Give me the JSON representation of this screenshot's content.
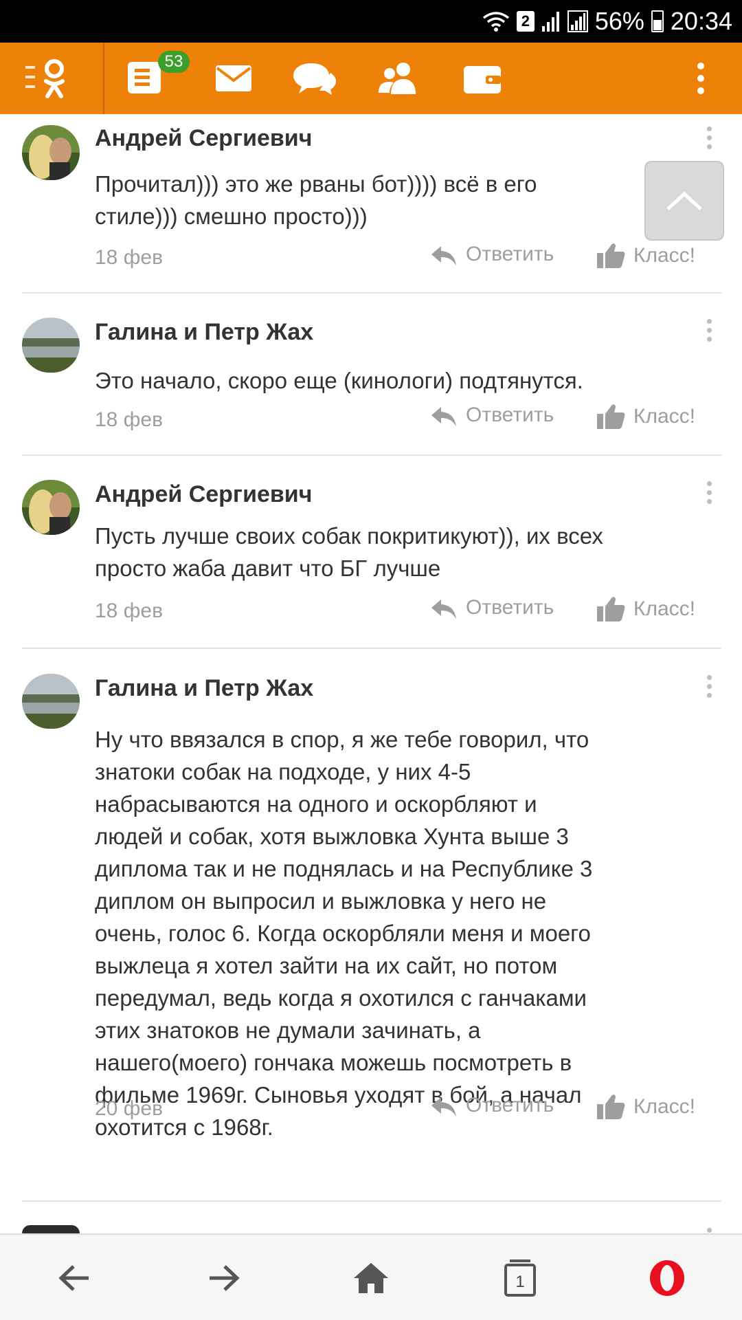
{
  "status_bar": {
    "sim": "2",
    "battery": "56%",
    "time": "20:34",
    "icons": [
      "wifi-icon",
      "signal-icon",
      "signal-icon",
      "battery-icon"
    ]
  },
  "app_bar": {
    "brand_color": "#ee8208",
    "notifications_badge": "53",
    "icons": [
      "ok-menu-icon",
      "feed-icon",
      "mail-icon",
      "chat-icon",
      "friends-icon",
      "wallet-icon",
      "more-vertical-icon"
    ]
  },
  "comments": [
    {
      "author": "Андрей Сергиевич",
      "text": "Прочитал))) это же рваны бот)))) всё в его\nстиле))) смешно просто)))",
      "date": "18 фев",
      "reply_label": "Ответить",
      "like_label": "Класс!"
    },
    {
      "author": "Галина и Петр Жах",
      "text": "Это начало, скоро  еще  (кинологи) подтянутся.",
      "date": "18 фев",
      "reply_label": "Ответить",
      "like_label": "Класс!"
    },
    {
      "author": "Андрей Сергиевич",
      "text": "Пусть лучше своих собак покритикуют)), их всех\nпросто жаба давит что БГ лучше",
      "date": "18 фев",
      "reply_label": "Ответить",
      "like_label": "Класс!"
    },
    {
      "author": "Галина и Петр Жах",
      "text": "Ну что ввязался в спор, я же тебе говорил,  что\nзнатоки собак на подходе, у них 4-5\nнабрасываются на одного и оскорбляют и\nлюдей и собак, хотя выжловка Хунта выше 3\nдиплома так и не поднялась  и на  Республике 3\nдиплом он выпросил и выжловка у него не\nочень, голос 6. Когда оскорбляли меня и моего\nвыжлеца  я хотел зайти на их сайт, но потом\nпередумал, ведь когда я охотился с ганчаками\nэтих знатоков не думали зачинать, а\n нашего(моего) гончака можешь посмотреть в\nфильме 1969г. Сыновья уходят в бой, а начал\nохотится с 1968г.",
      "date": "20 фев",
      "reply_label": "Ответить",
      "like_label": "Класс!"
    }
  ],
  "bottom_bar": {
    "tab_count": "1",
    "icons": [
      "back-arrow-icon",
      "forward-arrow-icon",
      "home-icon",
      "tabs-icon",
      "opera-logo-icon"
    ],
    "opera_color": "#e8101e"
  }
}
